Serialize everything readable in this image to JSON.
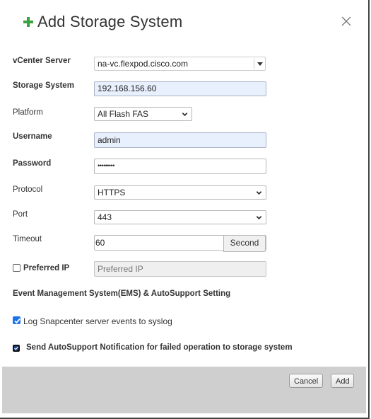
{
  "dialog": {
    "title": "Add Storage System",
    "title_icon": "plus-icon",
    "close_icon": "close-icon"
  },
  "form": {
    "vcenter": {
      "label": "vCenter Server",
      "value": "na-vc.flexpod.cisco.com"
    },
    "storage_system": {
      "label": "Storage System",
      "value": "192.168.156.60"
    },
    "platform": {
      "label": "Platform",
      "value": "All Flash FAS"
    },
    "username": {
      "label": "Username",
      "value": "admin"
    },
    "password": {
      "label": "Password",
      "value": "•••••••••"
    },
    "protocol": {
      "label": "Protocol",
      "value": "HTTPS"
    },
    "port": {
      "label": "Port",
      "value": "443"
    },
    "timeout": {
      "label": "Timeout",
      "value": "60",
      "unit": "Second"
    },
    "preferred_ip": {
      "label": "Preferred IP",
      "placeholder": "Preferred IP",
      "checked": false
    }
  },
  "ems": {
    "section_title": "Event Management System(EMS) & AutoSupport Setting",
    "log_syslog": {
      "label": "Log Snapcenter server events to syslog",
      "checked": true
    },
    "autosupport": {
      "label": "Send AutoSupport Notification for failed operation to storage system",
      "checked": true
    }
  },
  "footer": {
    "cancel_label": "Cancel",
    "add_label": "Add"
  },
  "colors": {
    "accent_green": "#3aa040",
    "checkbox_blue": "#1a73e8",
    "autofill_blue": "#e8f0fe",
    "footer_gray": "#cfcfcf"
  }
}
